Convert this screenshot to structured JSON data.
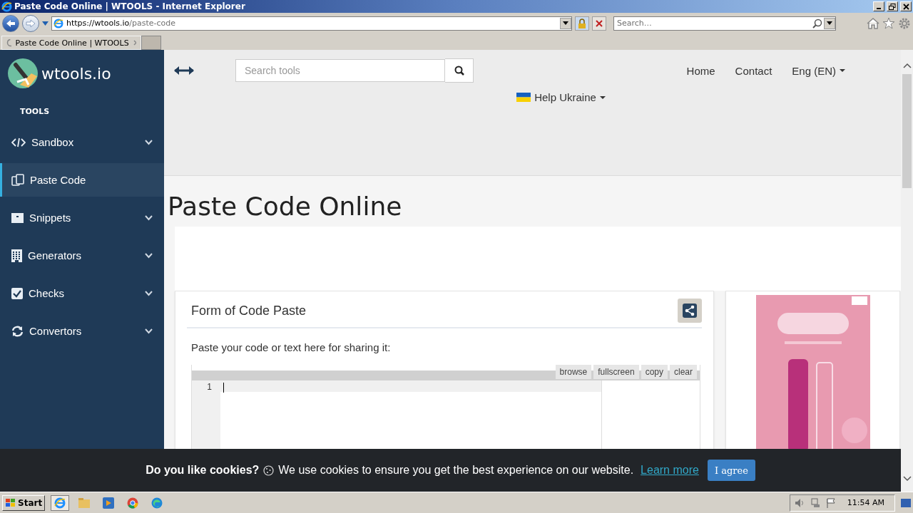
{
  "window": {
    "title": "Paste Code Online | WTOOLS - Internet Explorer"
  },
  "address_bar": {
    "url_host": "https://wtools.io",
    "url_path": "/paste-code"
  },
  "browser_search": {
    "placeholder": "Search…"
  },
  "tabs": [
    {
      "label": "Paste Code Online | WTOOLS",
      "selected": true
    }
  ],
  "sidebar": {
    "logo": "wtools.io",
    "section": "TOOLS",
    "items": [
      {
        "label": "Sandbox",
        "kind": "code",
        "expandable": true,
        "selected": false
      },
      {
        "label": "Paste Code",
        "kind": "paste",
        "expandable": false,
        "selected": true
      },
      {
        "label": "Snippets",
        "kind": "archive",
        "expandable": true,
        "selected": false
      },
      {
        "label": "Generators",
        "kind": "building",
        "expandable": true,
        "selected": false
      },
      {
        "label": "Checks",
        "kind": "check",
        "expandable": true,
        "selected": false
      },
      {
        "label": "Convertors",
        "kind": "refresh",
        "expandable": true,
        "selected": false
      }
    ]
  },
  "header": {
    "search": {
      "placeholder": "Search tools"
    },
    "nav": [
      {
        "label": "Home",
        "dropdown": false
      },
      {
        "label": "Contact",
        "dropdown": false
      },
      {
        "label": "Eng (EN)",
        "dropdown": true
      }
    ],
    "help": {
      "label": "Help Ukraine",
      "dropdown": true
    }
  },
  "page": {
    "title": "Paste Code Online"
  },
  "form": {
    "title": "Form of Code Paste",
    "prompt": "Paste your code or text here for sharing it:",
    "editor": {
      "buttons": [
        "browse",
        "fullscreen",
        "copy",
        "clear"
      ],
      "line_numbers": [
        "1"
      ]
    }
  },
  "cookie_bar": {
    "title": "Do you like cookies?",
    "message": "We use cookies to ensure you get the best experience on our website.",
    "link": "Learn more",
    "button": "I agree"
  },
  "taskbar": {
    "start": "Start",
    "clock": "11:54 AM"
  }
}
